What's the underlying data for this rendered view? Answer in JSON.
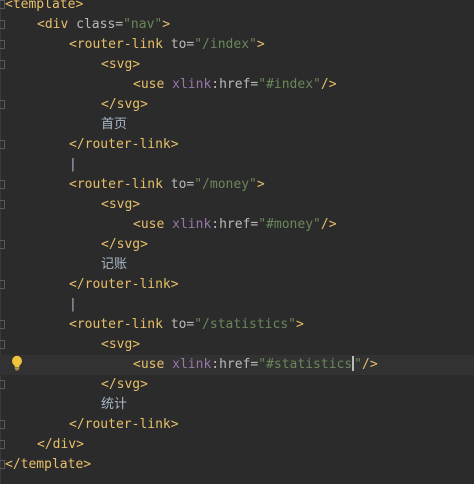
{
  "editor": {
    "lines": [
      {
        "tokens": [
          [
            "tag",
            "<template>"
          ]
        ]
      },
      {
        "tokens": [
          [
            "tag",
            "<div "
          ],
          [
            "attr",
            "class="
          ],
          [
            "str",
            "\"nav\""
          ],
          [
            "tag",
            ">"
          ]
        ]
      },
      {
        "tokens": [
          [
            "tag",
            "<router-link "
          ],
          [
            "attr",
            "to="
          ],
          [
            "str",
            "\"/index\""
          ],
          [
            "tag",
            ">"
          ]
        ]
      },
      {
        "tokens": [
          [
            "tag",
            "<svg>"
          ]
        ]
      },
      {
        "tokens": [
          [
            "tag",
            "<use "
          ],
          [
            "ns",
            "xlink"
          ],
          [
            "attr",
            ":href="
          ],
          [
            "str",
            "\"#index\""
          ],
          [
            "tag",
            "/>"
          ]
        ]
      },
      {
        "tokens": [
          [
            "tag",
            "</svg>"
          ]
        ]
      },
      {
        "tokens": [
          [
            "txt",
            "首页"
          ]
        ]
      },
      {
        "tokens": [
          [
            "tag",
            "</router-link>"
          ]
        ]
      },
      {
        "tokens": [
          [
            "txt",
            "|"
          ]
        ]
      },
      {
        "tokens": [
          [
            "tag",
            "<router-link "
          ],
          [
            "attr",
            "to="
          ],
          [
            "str",
            "\"/money\""
          ],
          [
            "tag",
            ">"
          ]
        ]
      },
      {
        "tokens": [
          [
            "tag",
            "<svg>"
          ]
        ]
      },
      {
        "tokens": [
          [
            "tag",
            "<use "
          ],
          [
            "ns",
            "xlink"
          ],
          [
            "attr",
            ":href="
          ],
          [
            "str",
            "\"#money\""
          ],
          [
            "tag",
            "/>"
          ]
        ]
      },
      {
        "tokens": [
          [
            "tag",
            "</svg>"
          ]
        ]
      },
      {
        "tokens": [
          [
            "txt",
            "记账"
          ]
        ]
      },
      {
        "tokens": [
          [
            "tag",
            "</router-link>"
          ]
        ]
      },
      {
        "tokens": [
          [
            "txt",
            "|"
          ]
        ]
      },
      {
        "tokens": [
          [
            "tag",
            "<router-link "
          ],
          [
            "attr",
            "to="
          ],
          [
            "str",
            "\"/statistics\""
          ],
          [
            "tag",
            ">"
          ]
        ]
      },
      {
        "tokens": [
          [
            "tag",
            "<svg>"
          ]
        ]
      },
      {
        "tokens": [
          [
            "tag",
            "<use "
          ],
          [
            "ns",
            "xlink"
          ],
          [
            "attr",
            ":href="
          ],
          [
            "str",
            "\"#statistics"
          ],
          [
            "caret",
            ""
          ],
          [
            "str",
            "\""
          ],
          [
            "tag",
            "/>"
          ]
        ]
      },
      {
        "tokens": [
          [
            "tag",
            "</svg>"
          ]
        ]
      },
      {
        "tokens": [
          [
            "txt",
            "统计"
          ]
        ]
      },
      {
        "tokens": [
          [
            "tag",
            "</router-link>"
          ]
        ]
      },
      {
        "tokens": [
          [
            "tag",
            "</div>"
          ]
        ]
      },
      {
        "tokens": [
          [
            "tag",
            "</template>"
          ]
        ]
      }
    ],
    "active_line": 18,
    "colors": {
      "background": "#2b2b2b",
      "tag": "#e8bf6a",
      "attribute": "#bababa",
      "namespace": "#9876aa",
      "string": "#6a8759",
      "text": "#a9b7c6",
      "intention_bulb": "#f0c33c"
    },
    "gutter_icon": "intention-bulb-icon"
  }
}
